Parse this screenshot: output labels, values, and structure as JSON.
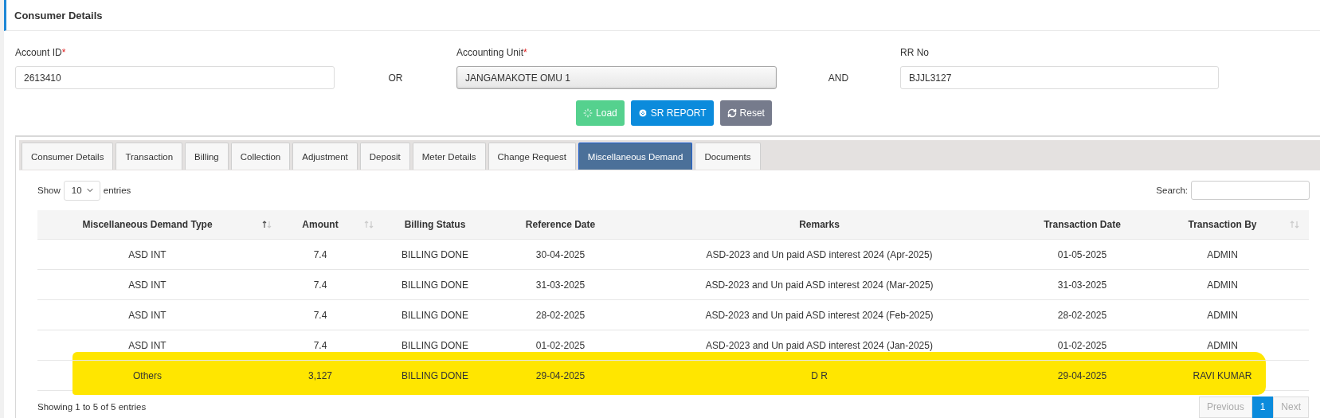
{
  "header": {
    "title": "Consumer Details"
  },
  "form": {
    "fields": [
      {
        "label": "Account ID",
        "required_mark": "*",
        "value": "2613410",
        "kind": "input"
      },
      {
        "label": "Accounting Unit",
        "required_mark": "*",
        "value": "JANGAMAKOTE OMU 1",
        "kind": "select"
      },
      {
        "label": "RR No",
        "value": "BJJL3127",
        "kind": "input"
      }
    ],
    "connectors": [
      "OR",
      "AND"
    ],
    "buttons": [
      {
        "label": "Load",
        "kind": "success"
      },
      {
        "label": "SR REPORT",
        "kind": "primary"
      },
      {
        "label": "Reset",
        "kind": "secondary"
      }
    ]
  },
  "tabs": [
    {
      "label": "Consumer Details",
      "selected": false
    },
    {
      "label": "Transaction",
      "selected": false
    },
    {
      "label": "Billing",
      "selected": false
    },
    {
      "label": "Collection",
      "selected": false
    },
    {
      "label": "Adjustment",
      "selected": false
    },
    {
      "label": "Deposit",
      "selected": false
    },
    {
      "label": "Meter Details",
      "selected": false
    },
    {
      "label": "Change Request",
      "selected": false
    },
    {
      "label": "Miscellaneous Demand",
      "selected": true
    },
    {
      "label": "Documents",
      "selected": false
    }
  ],
  "table": {
    "length": {
      "before": "Show",
      "value": "10",
      "after": "entries"
    },
    "search": {
      "label": "Search:"
    },
    "columns": [
      {
        "label": "Miscellaneous Demand Type",
        "sortable": true,
        "sorted": true
      },
      {
        "label": "Amount",
        "sortable": true,
        "sorted": false
      },
      {
        "label": "Billing Status"
      },
      {
        "label": "Reference Date"
      },
      {
        "label": "Remarks"
      },
      {
        "label": "Transaction Date"
      },
      {
        "label": "Transaction By",
        "sortable": true,
        "sorted": false
      }
    ],
    "rows": [
      {
        "cells": [
          "ASD INT",
          "7.4",
          "BILLING DONE",
          "30-04-2025",
          "ASD-2023 and Un paid ASD interest 2024 (Apr-2025)",
          "01-05-2025",
          "ADMIN"
        ],
        "highlighted": false
      },
      {
        "cells": [
          "ASD INT",
          "7.4",
          "BILLING DONE",
          "31-03-2025",
          "ASD-2023 and Un paid ASD interest 2024 (Mar-2025)",
          "31-03-2025",
          "ADMIN"
        ],
        "highlighted": false
      },
      {
        "cells": [
          "ASD INT",
          "7.4",
          "BILLING DONE",
          "28-02-2025",
          "ASD-2023 and Un paid ASD interest 2024 (Feb-2025)",
          "28-02-2025",
          "ADMIN"
        ],
        "highlighted": false
      },
      {
        "cells": [
          "ASD INT",
          "7.4",
          "BILLING DONE",
          "01-02-2025",
          "ASD-2023 and Un paid ASD interest 2024 (Jan-2025)",
          "01-02-2025",
          "ADMIN"
        ],
        "highlighted": false
      },
      {
        "cells": [
          "Others",
          "3,127",
          "BILLING DONE",
          "29-04-2025",
          "D R",
          "29-04-2025",
          "RAVI KUMAR"
        ],
        "highlighted": true
      }
    ],
    "info": "Showing 1 to 5 of 5 entries",
    "pagination": {
      "previous": {
        "label": "Previous",
        "disabled": true
      },
      "pages": [
        {
          "label": "1",
          "selected": true
        }
      ],
      "next": {
        "label": "Next",
        "disabled": true
      }
    }
  }
}
